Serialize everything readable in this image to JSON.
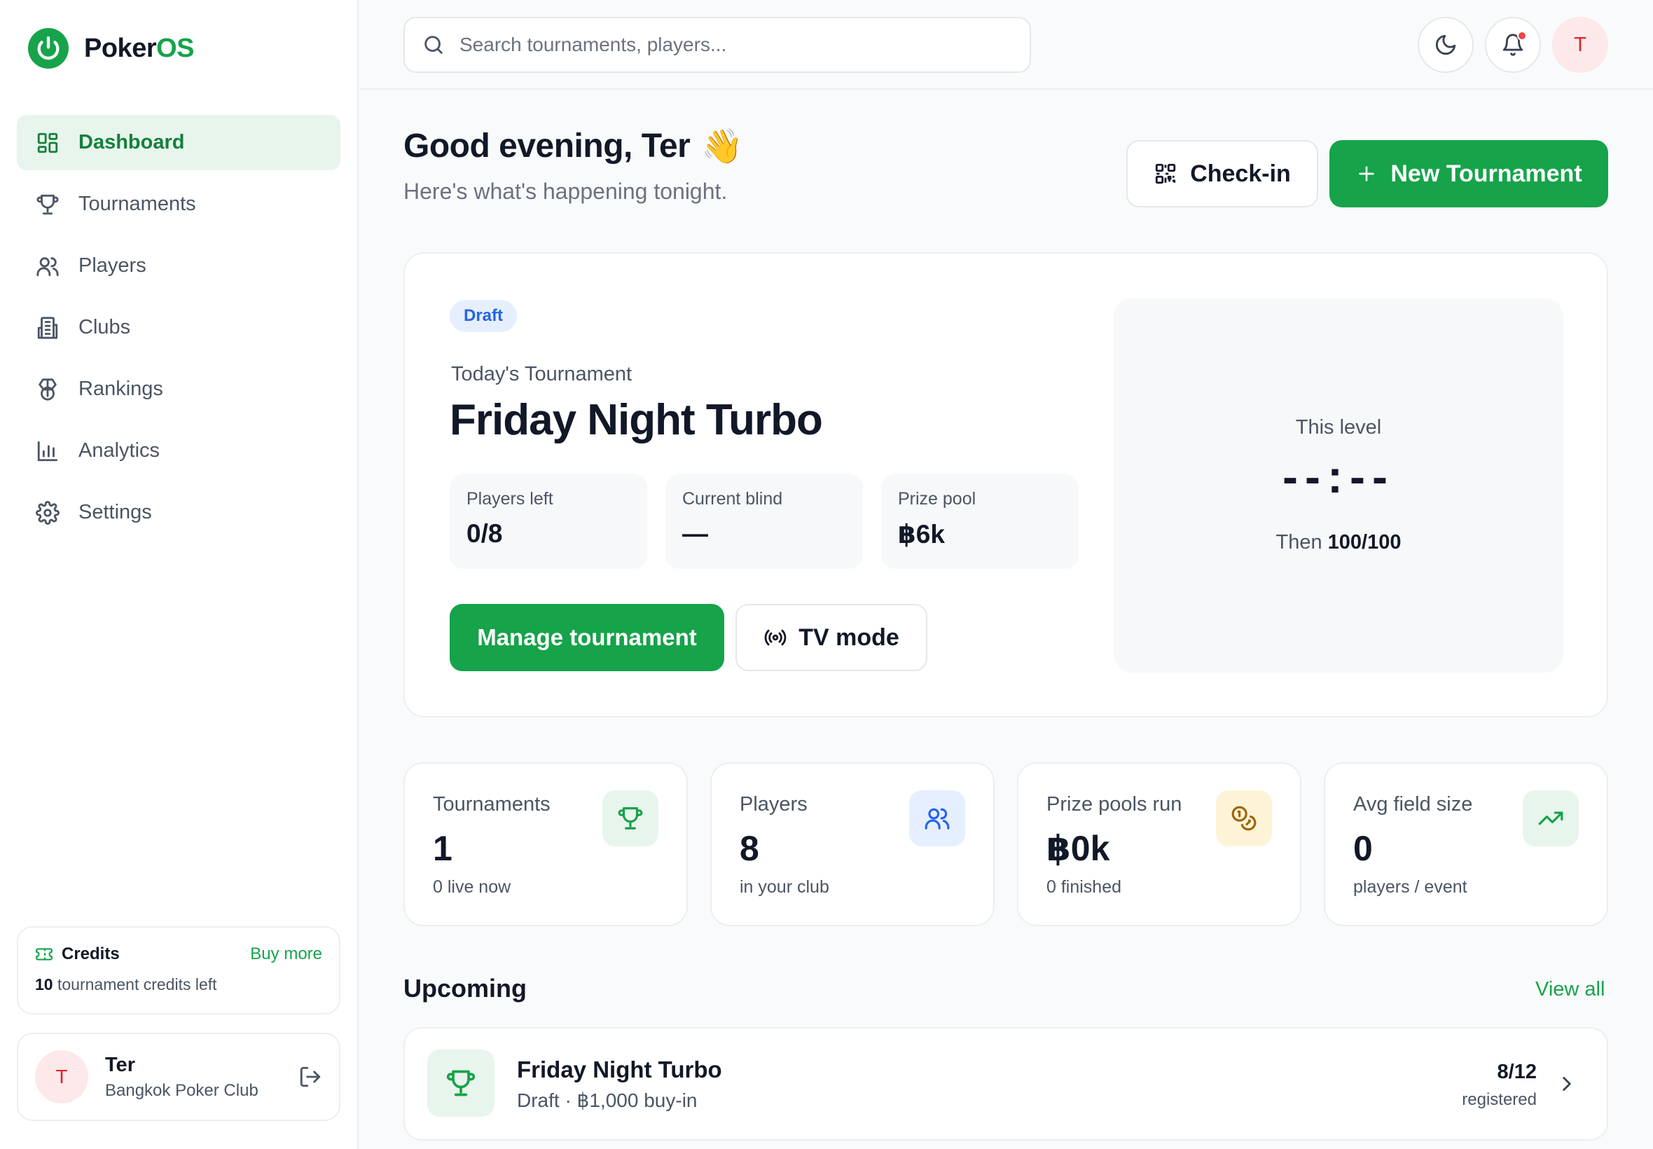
{
  "app": {
    "brand_prefix": "Poker",
    "brand_suffix": "OS"
  },
  "sidebar": {
    "items": [
      {
        "label": "Dashboard",
        "icon": "layout-dashboard-icon",
        "active": true
      },
      {
        "label": "Tournaments",
        "icon": "trophy-icon"
      },
      {
        "label": "Players",
        "icon": "users-icon"
      },
      {
        "label": "Clubs",
        "icon": "building-icon"
      },
      {
        "label": "Rankings",
        "icon": "medal-icon"
      },
      {
        "label": "Analytics",
        "icon": "bar-chart-icon"
      },
      {
        "label": "Settings",
        "icon": "gear-icon"
      }
    ],
    "credits": {
      "title": "Credits",
      "buy_more": "Buy more",
      "count": "10",
      "count_suffix": " tournament credits left"
    },
    "user": {
      "initial": "T",
      "name": "Ter",
      "club": "Bangkok Poker Club"
    }
  },
  "topbar": {
    "search_placeholder": "Search tournaments, players...",
    "avatar_initial": "T"
  },
  "greeting": {
    "title": "Good evening, Ter",
    "emoji": "👋",
    "subtitle": "Here's what's happening tonight."
  },
  "actions": {
    "checkin_label": "Check-in",
    "new_tournament_label": "New Tournament"
  },
  "hero": {
    "status_badge": "Draft",
    "label": "Today's Tournament",
    "title": "Friday Night Turbo",
    "stats": [
      {
        "label": "Players left",
        "value": "0/8"
      },
      {
        "label": "Current blind",
        "value": "—"
      },
      {
        "label": "Prize pool",
        "value": "฿6k"
      }
    ],
    "manage_label": "Manage tournament",
    "tv_label": "TV mode",
    "level": {
      "label": "This level",
      "timer": "--:--",
      "next_prefix": "Then ",
      "next_value": "100/100"
    }
  },
  "kpis": [
    {
      "label": "Tournaments",
      "value": "1",
      "sub": "0 live now",
      "icon": "trophy-icon",
      "icon_bg": "#e8f5ec",
      "icon_color": "#16a34a"
    },
    {
      "label": "Players",
      "value": "8",
      "sub": "in your club",
      "icon": "users-icon",
      "icon_bg": "#e6efff",
      "icon_color": "#2563eb"
    },
    {
      "label": "Prize pools run",
      "value": "฿0k",
      "sub": "0 finished",
      "icon": "coins-icon",
      "icon_bg": "#fdf4d8",
      "icon_color": "#a16207"
    },
    {
      "label": "Avg field size",
      "value": "0",
      "sub": "players / event",
      "icon": "trending-up-icon",
      "icon_bg": "#e8f5ec",
      "icon_color": "#16a34a"
    }
  ],
  "upcoming": {
    "title": "Upcoming",
    "view_all": "View all",
    "items": [
      {
        "title": "Friday Night Turbo",
        "sub": "Draft · ฿1,000 buy-in",
        "count": "8/12",
        "count_label": "registered"
      }
    ]
  },
  "colors": {
    "accent": "#16a34a",
    "accent_soft": "#e8f5ec",
    "draft_badge": "#2563eb",
    "notification": "#ef4444"
  }
}
